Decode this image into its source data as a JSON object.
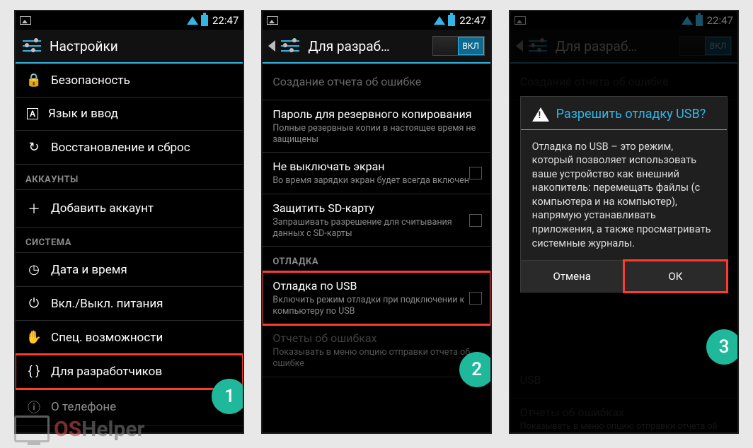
{
  "status": {
    "time": "22:47"
  },
  "screen1": {
    "title": "Настройки",
    "items": [
      {
        "icon": "lock",
        "label": "Безопасность"
      },
      {
        "icon": "lang",
        "label": "Язык и ввод"
      },
      {
        "icon": "restore",
        "label": "Восстановление и сброс"
      }
    ],
    "cat_accounts": "АККАУНТЫ",
    "add_account": "Добавить аккаунт",
    "cat_system": "СИСТЕМА",
    "system_items": [
      {
        "icon": "clock",
        "label": "Дата и время"
      },
      {
        "icon": "power",
        "label": "Вкл./Выкл. питания"
      },
      {
        "icon": "hand",
        "label": "Спец. возможности"
      },
      {
        "icon": "braces",
        "label": "Для разработчиков"
      },
      {
        "icon": "info",
        "label": "О телефоне"
      }
    ],
    "step": "1"
  },
  "screen2": {
    "title": "Для разраб…",
    "toggle_on": "ВКЛ",
    "items": {
      "bug_report": "Создание отчета об ошибке",
      "backup_pw": {
        "p": "Пароль для резервного копирования",
        "s": "Полные резервные копии в настоящее время не защищены"
      },
      "stay_awake": {
        "p": "Не выключать экран",
        "s": "Во время зарядки экран будет всегда включен"
      },
      "protect_sd": {
        "p": "Защитить SD-карту",
        "s": "Запрашивать разрешение для считывания данных с SD-карты"
      },
      "cat_debug": "ОТЛАДКА",
      "usb_debug": {
        "p": "Отладка по USB",
        "s": "Включить режим отладки при подключении к компьютеру по USB"
      },
      "error_reports": {
        "p": "Отчеты об ошибках",
        "s": "Показывать в меню опцию отправки отчета об ошибке"
      }
    },
    "step": "2"
  },
  "screen3": {
    "title": "Для разраб…",
    "toggle_on": "ВКЛ",
    "dialog": {
      "title": "Разрешить отладку USB?",
      "body": "Отладка по USB – это режим, который позволяет использовать ваше устройство как внешний накопитель: перемещать файлы (с компьютера и на компьютер), напрямую устанавливать приложения, а также просматривать системные журналы.",
      "cancel": "Отмена",
      "ok": "ОК"
    },
    "behind": {
      "bug_report": "Создание отчета об ошибке",
      "usb": "USB",
      "err1": "Отчеты об ошибках",
      "err2": "Показывать в меню опцию отправки отчета об ошибке"
    },
    "step": "3"
  },
  "watermark": {
    "t1": "OS",
    "t2": "Helper"
  }
}
